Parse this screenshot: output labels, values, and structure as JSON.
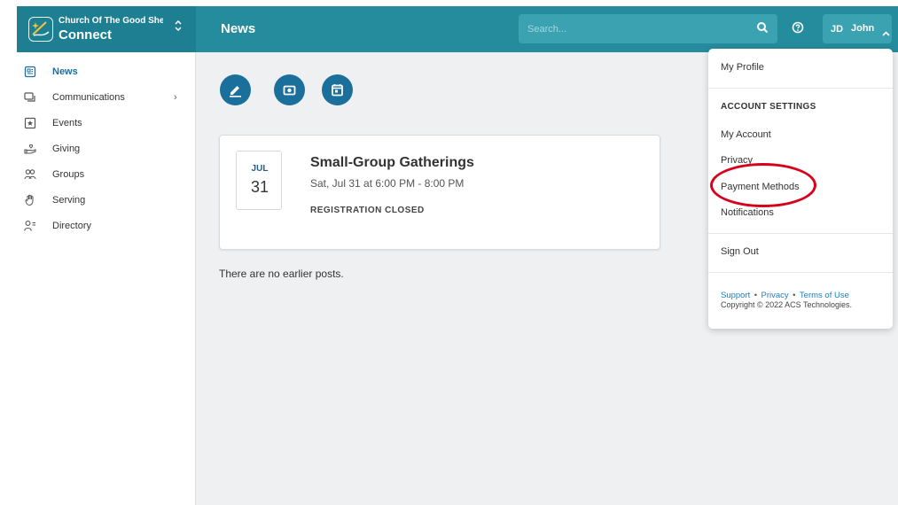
{
  "header": {
    "org_name": "Church Of The Good Shep...",
    "app_name": "Connect",
    "page_title": "News",
    "search_placeholder": "Search...",
    "user_initials": "JD",
    "user_name": "John"
  },
  "sidebar": {
    "items": [
      {
        "label": "News",
        "icon": "news-icon",
        "active": true
      },
      {
        "label": "Communications",
        "icon": "chat-icon",
        "has_submenu": true,
        "chevron": "›"
      },
      {
        "label": "Events",
        "icon": "star-calendar-icon"
      },
      {
        "label": "Giving",
        "icon": "giving-hand-icon"
      },
      {
        "label": "Groups",
        "icon": "groups-icon"
      },
      {
        "label": "Serving",
        "icon": "raised-hand-icon"
      },
      {
        "label": "Directory",
        "icon": "directory-person-icon"
      }
    ]
  },
  "actions": [
    {
      "name": "new-post-button",
      "icon": "pencil-icon"
    },
    {
      "name": "photo-post-button",
      "icon": "camera-icon"
    },
    {
      "name": "event-post-button",
      "icon": "calendar-icon"
    }
  ],
  "event": {
    "month": "JUL",
    "day": "31",
    "title": "Small-Group Gatherings",
    "time": "Sat, Jul 31 at 6:00 PM - 8:00 PM",
    "status": "REGISTRATION CLOSED"
  },
  "feed": {
    "empty_message": "There are no earlier posts."
  },
  "dropdown": {
    "my_profile": "My Profile",
    "account_settings_heading": "ACCOUNT SETTINGS",
    "my_account": "My Account",
    "privacy": "Privacy",
    "payment_methods": "Payment Methods",
    "notifications": "Notifications",
    "sign_out": "Sign Out",
    "footer_links": [
      "Support",
      "Privacy",
      "Terms of Use"
    ],
    "footer_separator": "•",
    "copyright": "Copyright © 2022 ACS Technologies."
  },
  "colors": {
    "header": "#258c9d",
    "header_dark": "#1d7f91",
    "accent": "#1a6f9b",
    "highlight_circle": "#d9001b"
  }
}
